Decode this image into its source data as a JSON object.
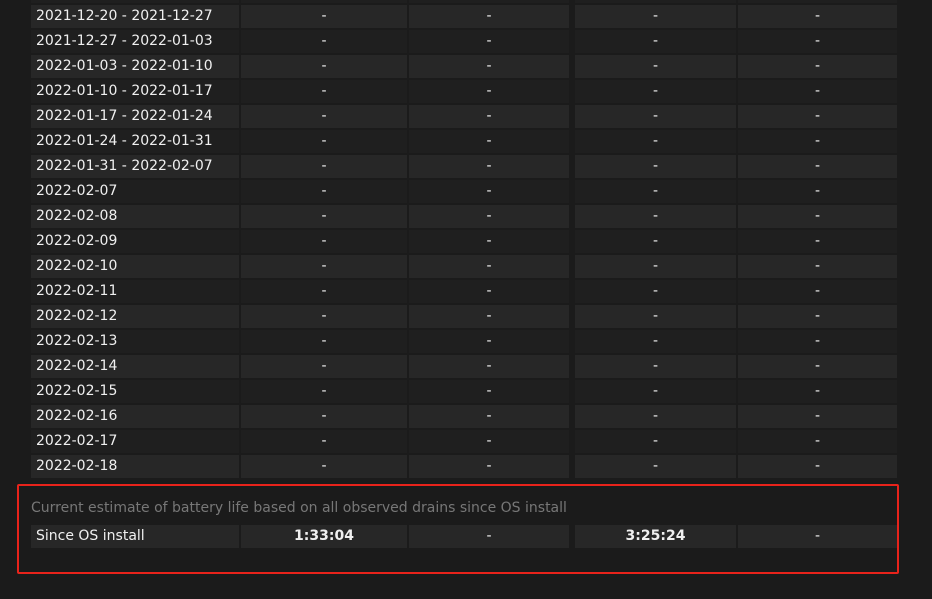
{
  "rows": [
    {
      "label": "",
      "values": [
        "-",
        "-",
        "-",
        "-"
      ]
    },
    {
      "label": "2021-12-20 - 2021-12-27",
      "values": [
        "-",
        "-",
        "-",
        "-"
      ]
    },
    {
      "label": "2021-12-27 - 2022-01-03",
      "values": [
        "-",
        "-",
        "-",
        "-"
      ]
    },
    {
      "label": "2022-01-03 - 2022-01-10",
      "values": [
        "-",
        "-",
        "-",
        "-"
      ]
    },
    {
      "label": "2022-01-10 - 2022-01-17",
      "values": [
        "-",
        "-",
        "-",
        "-"
      ]
    },
    {
      "label": "2022-01-17 - 2022-01-24",
      "values": [
        "-",
        "-",
        "-",
        "-"
      ]
    },
    {
      "label": "2022-01-24 - 2022-01-31",
      "values": [
        "-",
        "-",
        "-",
        "-"
      ]
    },
    {
      "label": "2022-01-31 - 2022-02-07",
      "values": [
        "-",
        "-",
        "-",
        "-"
      ]
    },
    {
      "label": "2022-02-07",
      "values": [
        "-",
        "-",
        "-",
        "-"
      ]
    },
    {
      "label": "2022-02-08",
      "values": [
        "-",
        "-",
        "-",
        "-"
      ]
    },
    {
      "label": "2022-02-09",
      "values": [
        "-",
        "-",
        "-",
        "-"
      ]
    },
    {
      "label": "2022-02-10",
      "values": [
        "-",
        "-",
        "-",
        "-"
      ]
    },
    {
      "label": "2022-02-11",
      "values": [
        "-",
        "-",
        "-",
        "-"
      ]
    },
    {
      "label": "2022-02-12",
      "values": [
        "-",
        "-",
        "-",
        "-"
      ]
    },
    {
      "label": "2022-02-13",
      "values": [
        "-",
        "-",
        "-",
        "-"
      ]
    },
    {
      "label": "2022-02-14",
      "values": [
        "-",
        "-",
        "-",
        "-"
      ]
    },
    {
      "label": "2022-02-15",
      "values": [
        "-",
        "-",
        "-",
        "-"
      ]
    },
    {
      "label": "2022-02-16",
      "values": [
        "-",
        "-",
        "-",
        "-"
      ]
    },
    {
      "label": "2022-02-17",
      "values": [
        "-",
        "-",
        "-",
        "-"
      ]
    },
    {
      "label": "2022-02-18",
      "values": [
        "-",
        "-",
        "-",
        "-"
      ]
    }
  ],
  "estimate": {
    "caption": "Current estimate of battery life based on all observed drains since OS install",
    "label": "Since OS install",
    "values": [
      "1:33:04",
      "-",
      "3:25:24",
      "-"
    ],
    "highlight_color": "#e8231b"
  }
}
